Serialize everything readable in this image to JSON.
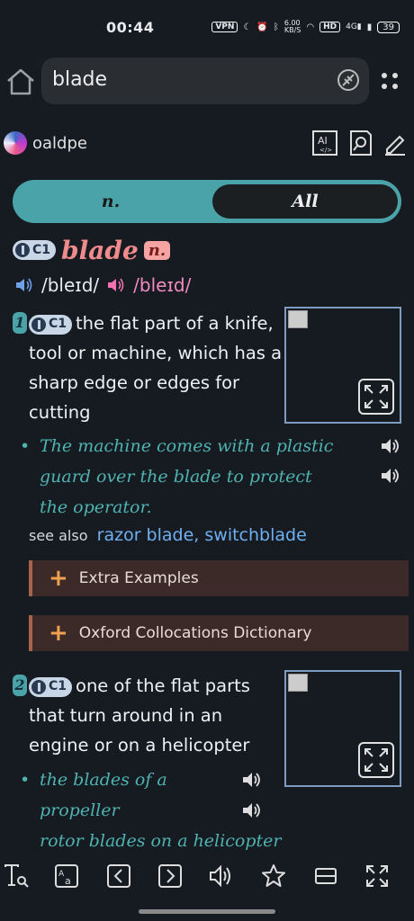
{
  "status": {
    "time": "00:44",
    "vpn": "VPN",
    "speed": "6.00\nKB/S",
    "net": "4G",
    "battery": "39"
  },
  "search": {
    "query": "blade"
  },
  "dict": {
    "name": "oaldpe",
    "ai_label": "AI"
  },
  "tabs": {
    "pos": "n.",
    "all": "All"
  },
  "entry": {
    "headword": "blade",
    "pos": "n.",
    "level": "C1",
    "ipa_uk": "/bleɪd/",
    "ipa_us": "/bleɪd/"
  },
  "senses": [
    {
      "num": "1",
      "level": "C1",
      "def": "the flat part of a knife, tool or machine, which has a sharp edge or edges for cutting",
      "examples": [
        "The machine comes with a plastic guard over the blade to protect the operator."
      ],
      "see_also_label": "see also",
      "see_also": [
        "razor blade",
        "switchblade"
      ]
    },
    {
      "num": "2",
      "level": "C1",
      "def": "one of the flat parts that turn around in an engine or on a helicopter",
      "examples": [
        "the blades of a propeller",
        "rotor blades on a helicopter"
      ]
    }
  ],
  "expanders": {
    "extra": "Extra Examples",
    "collocations": "Oxford Collocations Dictionary"
  },
  "colors": {
    "bg": "#161b22",
    "accent": "#4aa3a8",
    "headword": "#f08b8b",
    "example": "#4fb3b0",
    "link": "#6fb0f0"
  }
}
